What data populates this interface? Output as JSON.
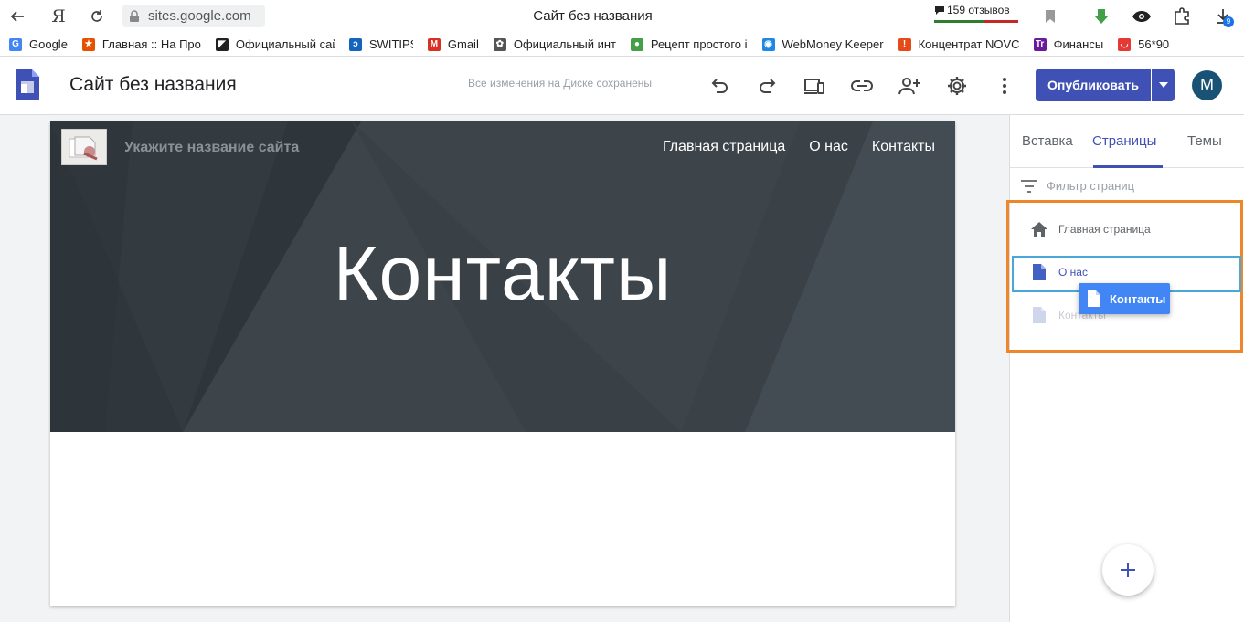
{
  "browser": {
    "url": "sites.google.com",
    "tab_title": "Сайт без названия",
    "reviews_count": "159 отзывов",
    "downloads_badge": "9"
  },
  "bookmarks": [
    {
      "label": "Google",
      "icon": "google-icon",
      "color": "#4285f4"
    },
    {
      "label": "Главная :: На Про",
      "icon": "star-icon",
      "color": "#e65100"
    },
    {
      "label": "Официальный сай",
      "icon": "flag-icon",
      "color": "#222222"
    },
    {
      "label": "SWITIPS",
      "icon": "switips-icon",
      "color": "#1565c0"
    },
    {
      "label": "Gmail",
      "icon": "gmail-icon",
      "color": "#d93025"
    },
    {
      "label": "Официальный инт",
      "icon": "flower-icon",
      "color": "#555555"
    },
    {
      "label": "Рецепт простого і",
      "icon": "recipe-icon",
      "color": "#43a047"
    },
    {
      "label": "WebMoney Keeper",
      "icon": "globe-icon",
      "color": "#1e88e5"
    },
    {
      "label": "Концентрат NOVC",
      "icon": "novc-icon",
      "color": "#e64a19"
    },
    {
      "label": "Финансы",
      "icon": "finance-icon",
      "color": "#6a1b9a"
    },
    {
      "label": "56*90",
      "icon": "shop-icon",
      "color": "#e53935"
    }
  ],
  "header": {
    "site_name": "Сайт без названия",
    "saved_status": "Все изменения на Диске сохранены",
    "publish_label": "Опубликовать",
    "avatar_letter": "M",
    "accent": "#3f51b5"
  },
  "site": {
    "placeholder_title": "Укажите название сайта",
    "nav": [
      "Главная страница",
      "О нас",
      "Контакты"
    ],
    "hero_heading": "Контакты"
  },
  "panel": {
    "tabs": [
      "Вставка",
      "Страницы",
      "Темы"
    ],
    "active_tab": "Страницы",
    "filter_placeholder": "Фильтр страниц",
    "pages": [
      {
        "label": "Главная страница",
        "icon": "home-icon"
      },
      {
        "label": "О нас",
        "icon": "page-icon"
      },
      {
        "label": "Контакты",
        "icon": "page-icon"
      }
    ],
    "dragging_label": "Контакты"
  }
}
